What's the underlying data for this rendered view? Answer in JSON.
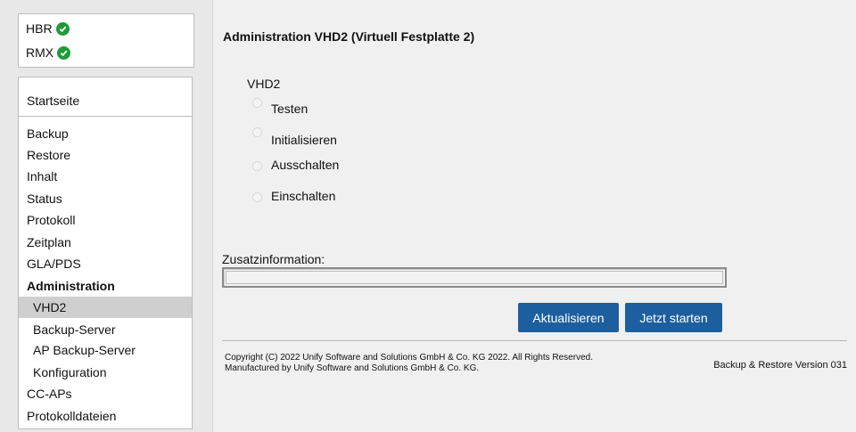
{
  "status": [
    {
      "label": "HBR",
      "state": "ok"
    },
    {
      "label": "RMX",
      "state": "ok"
    }
  ],
  "nav": {
    "home": "Startseite",
    "items": [
      "Backup",
      "Restore",
      "Inhalt",
      "Status",
      "Protokoll",
      "Zeitplan",
      "GLA/PDS"
    ],
    "section": "Administration",
    "sub_items": [
      "VHD2",
      "Backup-Server",
      "AP Backup-Server",
      "Konfiguration"
    ],
    "active": "VHD2",
    "tail_items": [
      "CC-APs",
      "Protokolldateien"
    ]
  },
  "main": {
    "title": "Administration VHD2 (Virtuell Festplatte 2)",
    "group_label": "VHD2",
    "options": [
      "Testen",
      "Initialisieren",
      "Ausschalten",
      "Einschalten"
    ],
    "zusatz_label": "Zusatzinformation:",
    "zusatz_value": "",
    "btn_refresh": "Aktualisieren",
    "btn_start": "Jetzt starten"
  },
  "footer": {
    "copyright_line1": "Copyright (C) 2022 Unify Software and Solutions GmbH & Co. KG 2022. All Rights Reserved.",
    "copyright_line2": "Manufactured by Unify Software and Solutions GmbH & Co. KG.",
    "version": "Backup & Restore Version 031"
  },
  "colors": {
    "accent": "#1d5f9e",
    "ok": "#1f9a3a",
    "active_bg": "#cfcfcf"
  }
}
